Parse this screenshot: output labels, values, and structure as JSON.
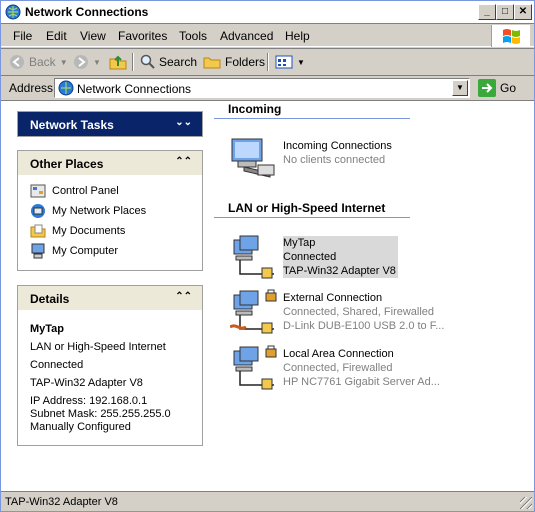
{
  "window": {
    "title": "Network Connections",
    "icon": "network-connections-icon",
    "controls": [
      "_",
      "□",
      "✕"
    ]
  },
  "menu": {
    "items": [
      "File",
      "Edit",
      "View",
      "Favorites",
      "Tools",
      "Advanced",
      "Help"
    ]
  },
  "toolbar": {
    "back": "Back",
    "search": "Search",
    "folders": "Folders"
  },
  "address": {
    "label": "Address",
    "value": "Network Connections",
    "go": "Go"
  },
  "left": {
    "network_tasks": {
      "title": "Network Tasks"
    },
    "other_places": {
      "title": "Other Places",
      "items": [
        {
          "label": "Control Panel",
          "icon": "control-panel-icon"
        },
        {
          "label": "My Network Places",
          "icon": "network-places-icon"
        },
        {
          "label": "My Documents",
          "icon": "documents-folder-icon"
        },
        {
          "label": "My Computer",
          "icon": "computer-icon"
        }
      ]
    },
    "details": {
      "title": "Details",
      "name": "MyTap",
      "type": "LAN or High-Speed Internet",
      "status": "Connected",
      "adapter": "TAP-Win32 Adapter V8",
      "ip": "IP Address: 192.168.0.1",
      "mask": "Subnet Mask: 255.255.255.0",
      "config": "Manually Configured"
    }
  },
  "right": {
    "incoming": {
      "title": "Incoming",
      "items": [
        {
          "name": "Incoming Connections",
          "status": "No clients connected",
          "icon": "incoming-connection-icon"
        }
      ]
    },
    "lan": {
      "title": "LAN or High-Speed Internet",
      "items": [
        {
          "name": "MyTap",
          "status": "Connected",
          "device": "TAP-Win32 Adapter V8",
          "selected": true,
          "icon": "lan-connection-icon"
        },
        {
          "name": "External Connection",
          "status": "Connected, Shared, Firewalled",
          "device": "D-Link DUB-E100 USB 2.0 to F...",
          "selected": false,
          "icon": "lan-connection-shared-icon"
        },
        {
          "name": "Local Area Connection",
          "status": "Connected, Firewalled",
          "device": "HP NC7761 Gigabit Server Ad...",
          "selected": false,
          "icon": "lan-connection-firewalled-icon"
        }
      ]
    }
  },
  "statusbar": {
    "text": "TAP-Win32 Adapter V8"
  },
  "colors": {
    "window_border": "#7a96df",
    "task_header": "#0a246a",
    "panel_header": "#ece9d8",
    "face": "#d4d0c8"
  }
}
